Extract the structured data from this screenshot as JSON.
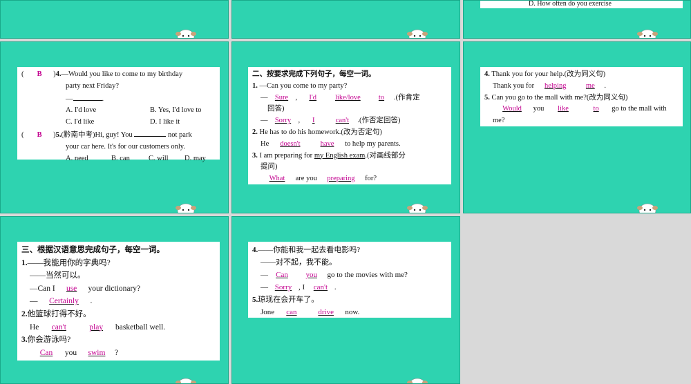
{
  "top": {
    "s3_tail": "D. How often do you exercise"
  },
  "s4": {
    "q4": {
      "bracket_l": "(",
      "ans": "B",
      "bracket_r": ")",
      "num": "4.",
      "text1": "—Would you like to come to my birthday",
      "text2": "party next Friday?",
      "dash": "—",
      "dot": ".",
      "A": "A. I'd love",
      "B": "B. Yes, I'd love to",
      "C": "C. I'd like",
      "D": "D. I like it"
    },
    "q5": {
      "bracket_l": "(",
      "ans": "B",
      "bracket_r": ")",
      "num": "5.",
      "text1a": "(黔南中考)Hi, guy! You",
      "text1b": "not park",
      "text2": "your car here. It's for our customers only.",
      "A": "A. need",
      "B": "B. can",
      "C": "C. will",
      "D": "D. may"
    }
  },
  "s5": {
    "heading": "二、按要求完成下列句子，每空一词。",
    "q1": {
      "num": "1.",
      "stem": "—Can you come to my party?",
      "a1_pre": "—",
      "a1": "Sure",
      "a1_sep": ",",
      "a2": "I'd",
      "a3": "like/love",
      "a4": "to",
      "a1_note": ".(作肯定",
      "a1_note2": "回答)",
      "b_pre": "—",
      "b1": "Sorry",
      "b_sep": ",",
      "b2": "I",
      "b3": "can't",
      "b_note": ".(作否定回答)"
    },
    "q2": {
      "num": "2.",
      "stem": "He has to do his homework.(改为否定句)",
      "pre": "He",
      "a1": "doesn't",
      "a2": "have",
      "post": "to help my parents."
    },
    "q3": {
      "num": "3.",
      "stem_pre": "I am preparing for",
      "stem_ul": "my English exam",
      "stem_post": ".(对画线部分",
      "stem2": "提问)",
      "a1": "What",
      "mid": "are you",
      "a2": "preparing",
      "post": "for?"
    }
  },
  "s6": {
    "q4": {
      "num": "4.",
      "stem": "Thank you for your help.(改为同义句)",
      "pre": "Thank you for",
      "a1": "helping",
      "a2": "me",
      "post": "."
    },
    "q5": {
      "num": "5.",
      "stem": "Can you go to the mall with me?(改为同义句)",
      "a1": "Would",
      "mid": "you",
      "a2": "like",
      "a3": "to",
      "post": "go to the mall with",
      "tail": "me?"
    }
  },
  "s7": {
    "heading": "三、根据汉语意思完成句子，每空一词。",
    "q1": {
      "num": "1.",
      "cn1": "——我能用你的字典吗?",
      "cn2": "——当然可以。",
      "pre": "—Can I",
      "a1": "use",
      "post": "your dictionary?",
      "b_pre": "—",
      "b1": "Certainly",
      "b_post": "."
    },
    "q2": {
      "num": "2.",
      "cn": "他篮球打得不好。",
      "pre": "He",
      "a1": "can't",
      "a2": "play",
      "post": "basketball well."
    },
    "q3": {
      "num": "3.",
      "cn": "你会游泳吗?",
      "a1": "Can",
      "mid": "you",
      "a2": "swim",
      "post": "?"
    }
  },
  "s8": {
    "q4": {
      "num": "4.",
      "cn1": "——你能和我一起去看电影吗?",
      "cn2": "——对不起，我不能。",
      "pre": "—",
      "a1": "Can",
      "a2": "you",
      "post": "go to the movies with me?",
      "b_pre": "—",
      "b1": "Sorry",
      "b_sep": ", I",
      "b2": "can't",
      "b_post": "."
    },
    "q5": {
      "num": "5.",
      "cn": "琼现在会开车了。",
      "pre": "Jone",
      "a1": "can",
      "a2": "drive",
      "post": "now."
    }
  },
  "colors": {
    "slide": "#2ed3b0",
    "answer": "#c3008f",
    "background": "#d9d9d9"
  }
}
